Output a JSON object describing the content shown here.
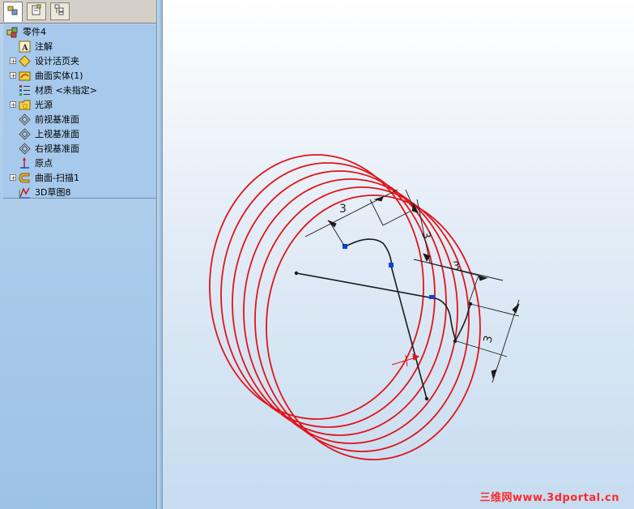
{
  "tabs": [
    {
      "label": "feature-manager",
      "icon": "feature-tree-icon",
      "active": true
    },
    {
      "label": "property-manager",
      "icon": "property-icon",
      "active": false
    },
    {
      "label": "configuration-manager",
      "icon": "config-icon",
      "active": false
    }
  ],
  "tree": {
    "root": "零件4",
    "items": [
      {
        "label": "注解",
        "icon": "annotation-icon",
        "expandable": false
      },
      {
        "label": "设计活页夹",
        "icon": "design-binder-icon",
        "expandable": true
      },
      {
        "label": "曲面实体(1)",
        "icon": "surface-bodies-icon",
        "expandable": true
      },
      {
        "label": "材质 <未指定>",
        "icon": "material-icon",
        "expandable": false
      },
      {
        "label": "光源",
        "icon": "lights-icon",
        "expandable": true
      },
      {
        "label": "前视基准面",
        "icon": "plane-icon",
        "expandable": false
      },
      {
        "label": "上视基准面",
        "icon": "plane-icon",
        "expandable": false
      },
      {
        "label": "右视基准面",
        "icon": "plane-icon",
        "expandable": false
      },
      {
        "label": "原点",
        "icon": "origin-icon",
        "expandable": false
      },
      {
        "label": "曲面-扫描1",
        "icon": "sweep-surface-icon",
        "expandable": true
      },
      {
        "label": "3D草图8",
        "icon": "3d-sketch-icon",
        "expandable": false
      }
    ]
  },
  "dimensions": [
    "3",
    "3",
    "3",
    "3"
  ],
  "colors": {
    "helix": "#e0141a",
    "sketch": "#1a1a1a",
    "point": "#1040d8"
  },
  "watermark": "三维网www.3dportal.cn"
}
